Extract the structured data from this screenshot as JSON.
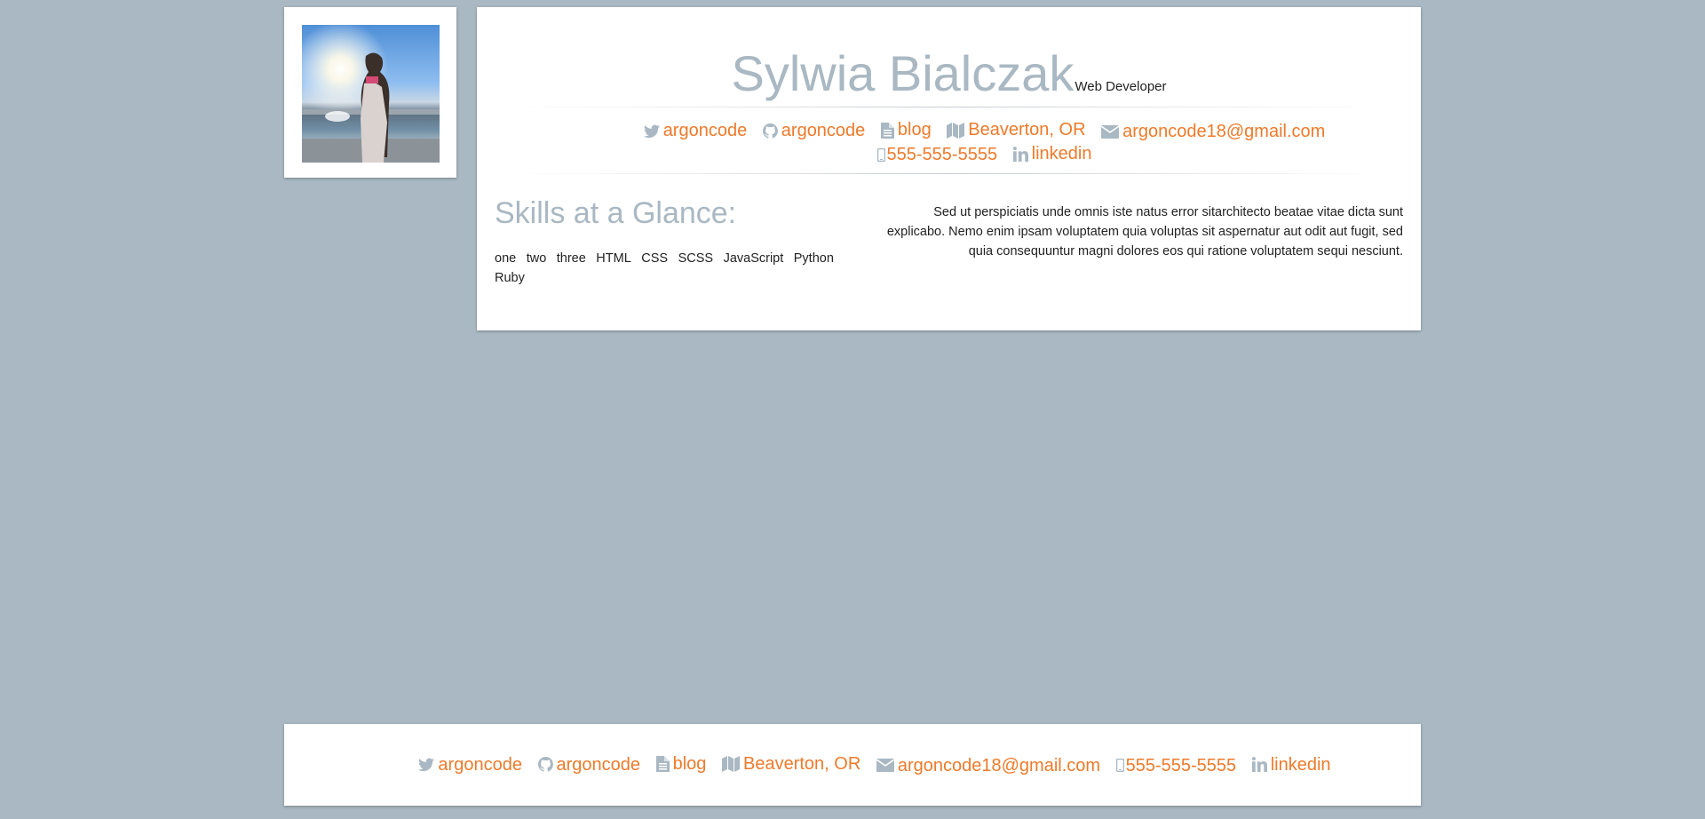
{
  "profile": {
    "name": "Sylwia Bialczak",
    "role": "Web Developer"
  },
  "contacts": [
    {
      "icon": "twitter-icon",
      "label": "argoncode"
    },
    {
      "icon": "github-icon",
      "label": "argoncode"
    },
    {
      "icon": "blog-icon",
      "label": "blog"
    },
    {
      "icon": "map-icon",
      "label": "Beaverton, OR"
    },
    {
      "icon": "envelope-icon",
      "label": "argoncode18@gmail.com"
    },
    {
      "icon": "phone-icon",
      "label": "555-555-5555"
    },
    {
      "icon": "linkedin-icon",
      "label": "linkedin"
    }
  ],
  "skills": {
    "title": "Skills at a Glance:",
    "items": [
      "one",
      "two",
      "three",
      "HTML",
      "CSS",
      "SCSS",
      "JavaScript",
      "Python",
      "Ruby"
    ]
  },
  "about": {
    "text": "Sed ut perspiciatis unde omnis iste natus error sitarchitecto beatae vitae dicta sunt explicabo. Nemo enim ipsam voluptatem quia voluptas sit aspernatur aut odit aut fugit, sed quia consequuntur magni dolores eos qui ratione voluptatem sequi nesciunt."
  },
  "colors": {
    "background": "#a9b8c2",
    "accent": "#ee7a2a",
    "heading": "#a9b8c2",
    "card": "#ffffff"
  }
}
